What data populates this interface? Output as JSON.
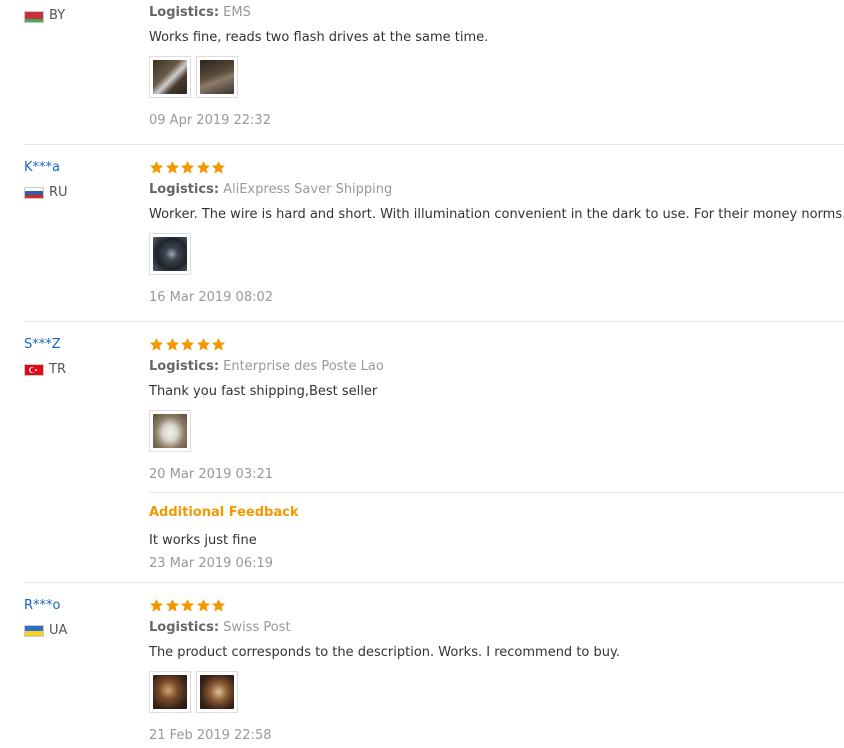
{
  "logistics_label": "Logistics:",
  "additional_feedback_title": "Additional Feedback",
  "colors": {
    "user_link": "#1a64c8",
    "star": "#f39800",
    "muted": "#999999",
    "additional_feedback": "#f39800"
  },
  "reviews": [
    {
      "user": "",
      "country": "BY",
      "flag": "belarus-flag",
      "logistics": "EMS",
      "text": "Works fine, reads two flash drives at the same time.",
      "photos": [
        "usb-reader-photo-1",
        "usb-reader-photo-2"
      ],
      "date": "09 Apr 2019 22:32"
    },
    {
      "user": "K***a",
      "country": "RU",
      "flag": "russia-flag",
      "rating": 5,
      "logistics": "AliExpress Saver Shipping",
      "text": "Worker. The wire is hard and short. With illumination convenient in the dark to use. For their money norms.",
      "photos": [
        "car-charger-photo"
      ],
      "date": "16 Mar 2019 08:02"
    },
    {
      "user": "S***Z",
      "country": "TR",
      "flag": "turkey-flag",
      "rating": 5,
      "logistics": "Enterprise des Poste Lao",
      "text": "Thank you fast shipping,Best seller",
      "photos": [
        "package-photo"
      ],
      "date": "20 Mar 2019 03:21",
      "additional": {
        "text": "It works just fine",
        "date": "23 Mar 2019 06:19"
      }
    },
    {
      "user": "R***o",
      "country": "UA",
      "flag": "ukraine-flag",
      "rating": 5,
      "logistics": "Swiss Post",
      "text": "The product corresponds to the description. Works. I recommend to buy.",
      "photos": [
        "product-photo-1",
        "product-photo-2"
      ],
      "date": "21 Feb 2019 22:58"
    }
  ]
}
